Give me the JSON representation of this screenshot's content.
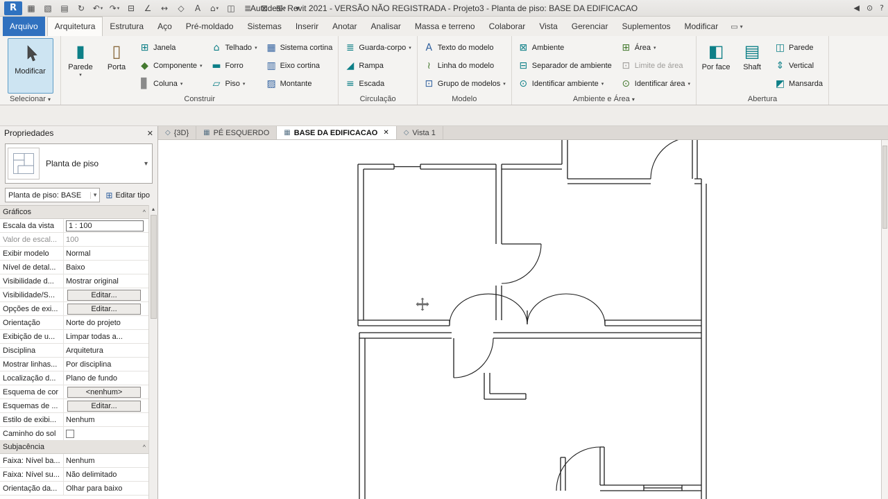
{
  "title_bar": {
    "title": "Autodesk Revit 2021 - VERSÃO NÃO REGISTRADA - Projeto3 - Planta de piso: BASE DA EDIFICACAO",
    "qat": [
      {
        "name": "revit-logo",
        "glyph": "R",
        "cls": "logo"
      },
      {
        "name": "new-file-icon",
        "glyph": "▦"
      },
      {
        "name": "open-icon",
        "glyph": "▧"
      },
      {
        "name": "save-icon",
        "glyph": "▤"
      },
      {
        "name": "sync-icon",
        "glyph": "↻"
      },
      {
        "name": "undo-icon",
        "glyph": "↶",
        "caret": true
      },
      {
        "name": "redo-icon",
        "glyph": "↷",
        "caret": true
      },
      {
        "name": "print-icon",
        "glyph": "⊟"
      },
      {
        "name": "measure-icon",
        "glyph": "∠"
      },
      {
        "name": "aligned-dimension-icon",
        "glyph": "↔"
      },
      {
        "name": "tag-icon",
        "glyph": "◇"
      },
      {
        "name": "text-icon",
        "glyph": "A"
      },
      {
        "name": "default-3d-view-icon",
        "glyph": "⌂",
        "caret": true
      },
      {
        "name": "section-icon",
        "glyph": "◫"
      },
      {
        "name": "thin-lines-icon",
        "glyph": "≣"
      },
      {
        "name": "close-hidden-windows-icon",
        "glyph": "⊠"
      },
      {
        "name": "switch-windows-icon",
        "glyph": "⊞",
        "caret": true
      },
      {
        "name": "customize-qat-icon",
        "glyph": "▾"
      }
    ],
    "right_icons": [
      {
        "name": "collapse-icon",
        "glyph": "◀"
      },
      {
        "name": "search-icon",
        "glyph": "⊙"
      },
      {
        "name": "help-icon",
        "glyph": "?"
      }
    ]
  },
  "ribbon": {
    "tabs": [
      {
        "label": "Arquivo",
        "kind": "file"
      },
      {
        "label": "Arquitetura",
        "kind": "active"
      },
      {
        "label": "Estrutura"
      },
      {
        "label": "Aço"
      },
      {
        "label": "Pré-moldado"
      },
      {
        "label": "Sistemas"
      },
      {
        "label": "Inserir"
      },
      {
        "label": "Anotar"
      },
      {
        "label": "Analisar"
      },
      {
        "label": "Massa e terreno"
      },
      {
        "label": "Colaborar"
      },
      {
        "label": "Vista"
      },
      {
        "label": "Gerenciar"
      },
      {
        "label": "Suplementos"
      },
      {
        "label": "Modificar"
      }
    ],
    "selecionar": {
      "label": "Selecionar",
      "modify": "Modificar"
    },
    "construir": {
      "label": "Construir",
      "parede": "Parede",
      "porta": "Porta",
      "janela": "Janela",
      "componente": "Componente",
      "coluna": "Coluna",
      "telhado": "Telhado",
      "forro": "Forro",
      "piso": "Piso",
      "sistema_cortina": "Sistema cortina",
      "eixo_cortina": "Eixo cortina",
      "montante": "Montante"
    },
    "circulacao": {
      "label": "Circulação",
      "guarda_corpo": "Guarda-corpo",
      "rampa": "Rampa",
      "escada": "Escada"
    },
    "modelo": {
      "label": "Modelo",
      "texto": "Texto do modelo",
      "linha": "Linha do modelo",
      "grupo": "Grupo de modelos"
    },
    "ambiente_area": {
      "label": "Ambiente e Área",
      "ambiente": "Ambiente",
      "separador": "Separador de ambiente",
      "identificar_ambiente": "Identificar ambiente",
      "area": "Área",
      "limite_area": "Limite de área",
      "identificar_area": "Identificar área"
    },
    "abertura": {
      "label": "Abertura",
      "por_face": "Por face",
      "shaft": "Shaft",
      "parede": "Parede",
      "vertical": "Vertical",
      "mansarda": "Mansarda"
    }
  },
  "properties": {
    "header": "Propriedades",
    "type_selector": "Planta de piso",
    "instance_combo": "Planta de piso: BASE",
    "edit_type": "Editar tipo",
    "sections": [
      {
        "title": "Gráficos",
        "rows": [
          {
            "label": "Escala da vista",
            "value": "1 : 100",
            "kind": "input"
          },
          {
            "label": "Valor de escal...",
            "value": "100",
            "kind": "disabled"
          },
          {
            "label": "Exibir modelo",
            "value": "Normal"
          },
          {
            "label": "Nível de detal...",
            "value": "Baixo"
          },
          {
            "label": "Visibilidade d...",
            "value": "Mostrar original"
          },
          {
            "label": "Visibilidade/S...",
            "value": "Editar...",
            "kind": "button"
          },
          {
            "label": "Opções de exi...",
            "value": "Editar...",
            "kind": "button"
          },
          {
            "label": "Orientação",
            "value": "Norte do projeto"
          },
          {
            "label": "Exibição de u...",
            "value": "Limpar todas a..."
          },
          {
            "label": "Disciplina",
            "value": "Arquitetura"
          },
          {
            "label": "Mostrar linhas...",
            "value": "Por disciplina"
          },
          {
            "label": "Localização d...",
            "value": "Plano de fundo"
          },
          {
            "label": "Esquema de cor",
            "value": "<nenhum>",
            "kind": "button"
          },
          {
            "label": "Esquemas de ...",
            "value": "Editar...",
            "kind": "button"
          },
          {
            "label": "Estilo de exibi...",
            "value": "Nenhum"
          },
          {
            "label": "Caminho do sol",
            "value": "",
            "kind": "checkbox"
          }
        ]
      },
      {
        "title": "Subjacência",
        "rows": [
          {
            "label": "Faixa: Nível ba...",
            "value": "Nenhum"
          },
          {
            "label": "Faixa: Nível su...",
            "value": "Não delimitado"
          },
          {
            "label": "Orientação da...",
            "value": "Olhar para baixo"
          }
        ]
      }
    ]
  },
  "view_tabs": [
    {
      "label": "{3D}",
      "icon": "◇"
    },
    {
      "label": "PÉ ESQUERDO",
      "icon": "▦"
    },
    {
      "label": "BASE DA EDIFICACAO",
      "icon": "▦",
      "active": true,
      "closable": true
    },
    {
      "label": "Vista 1",
      "icon": "◇"
    }
  ],
  "glyphs": {
    "caret": "▾",
    "close": "✕",
    "chevron": "^",
    "scroll_up": "▲",
    "combo_arrow": "▾"
  },
  "icons": {
    "parede": "▮",
    "porta": "▯",
    "janela": "⊞",
    "componente": "◆",
    "coluna": "▊",
    "telhado": "⌂",
    "forro": "▬",
    "piso": "▱",
    "sistema_cortina": "▦",
    "eixo_cortina": "▥",
    "montante": "▨",
    "guarda_corpo": "≣",
    "rampa": "◢",
    "escada": "≡",
    "texto": "A",
    "linha": "≀",
    "grupo": "⊡",
    "ambiente": "⊠",
    "separador": "⊟",
    "identificar_ambiente": "⊙",
    "area": "⊞",
    "limite_area": "⊡",
    "identificar_area": "⊙",
    "por_face": "◧",
    "shaft": "▤",
    "abertura_parede": "◫",
    "vertical": "⇕",
    "mansarda": "◩",
    "editar_tipo": "⊞",
    "ui_toggle": "▭"
  }
}
